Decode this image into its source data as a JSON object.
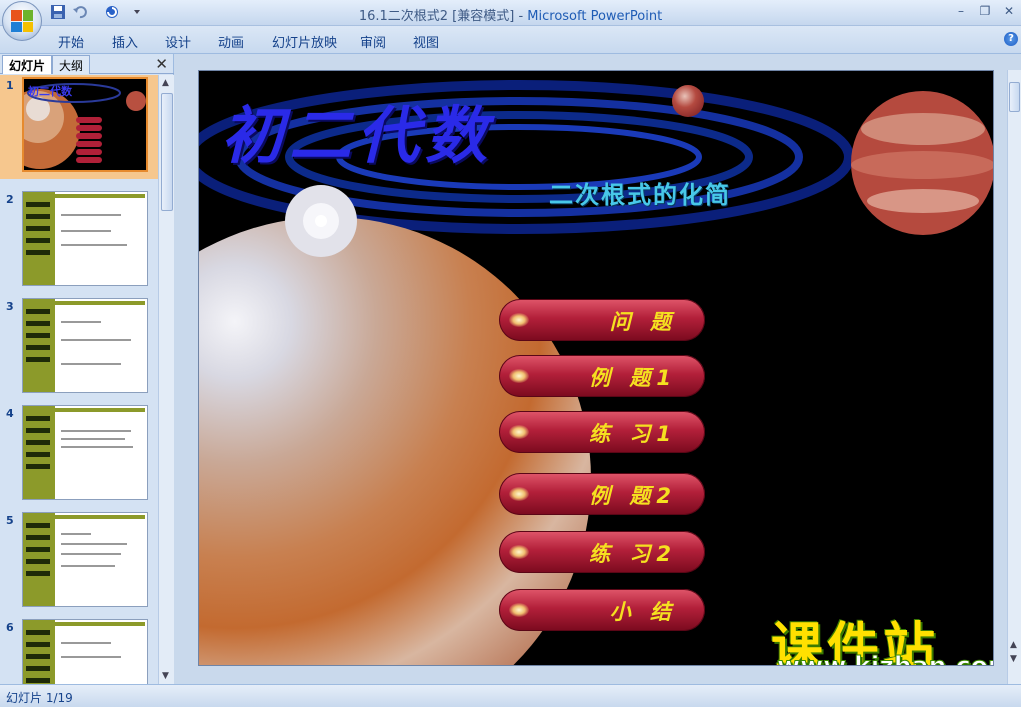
{
  "window": {
    "title_doc": "16.1二次根式2 [兼容模式]",
    "title_sep": " - ",
    "title_app": "Microsoft PowerPoint",
    "min": "–",
    "restore": "❐",
    "close": "✕"
  },
  "ribbon": {
    "tabs": [
      "开始",
      "插入",
      "设计",
      "动画",
      "幻灯片放映",
      "审阅",
      "视图"
    ],
    "help": "?"
  },
  "left_pane": {
    "tab_slides": "幻灯片",
    "tab_outline": "大纲",
    "close": "✕",
    "slide_numbers": [
      "1",
      "2",
      "3",
      "4",
      "5",
      "6"
    ],
    "selected": 1
  },
  "slide": {
    "title": "初二代数",
    "subtitle": "二次根式的化简",
    "menu": [
      "问 题",
      "例 题1",
      "练 习1",
      "例 题2",
      "练 习2",
      "小 结"
    ],
    "watermark_cn": "课件站",
    "watermark_url": "www.kjzhan.com"
  },
  "status": {
    "slide_info": "幻灯片 1/19"
  },
  "colors": {
    "accent": "#15428b",
    "slide_bg": "#000000",
    "menu_text": "#f5e020",
    "title": "#2a2ae8"
  }
}
